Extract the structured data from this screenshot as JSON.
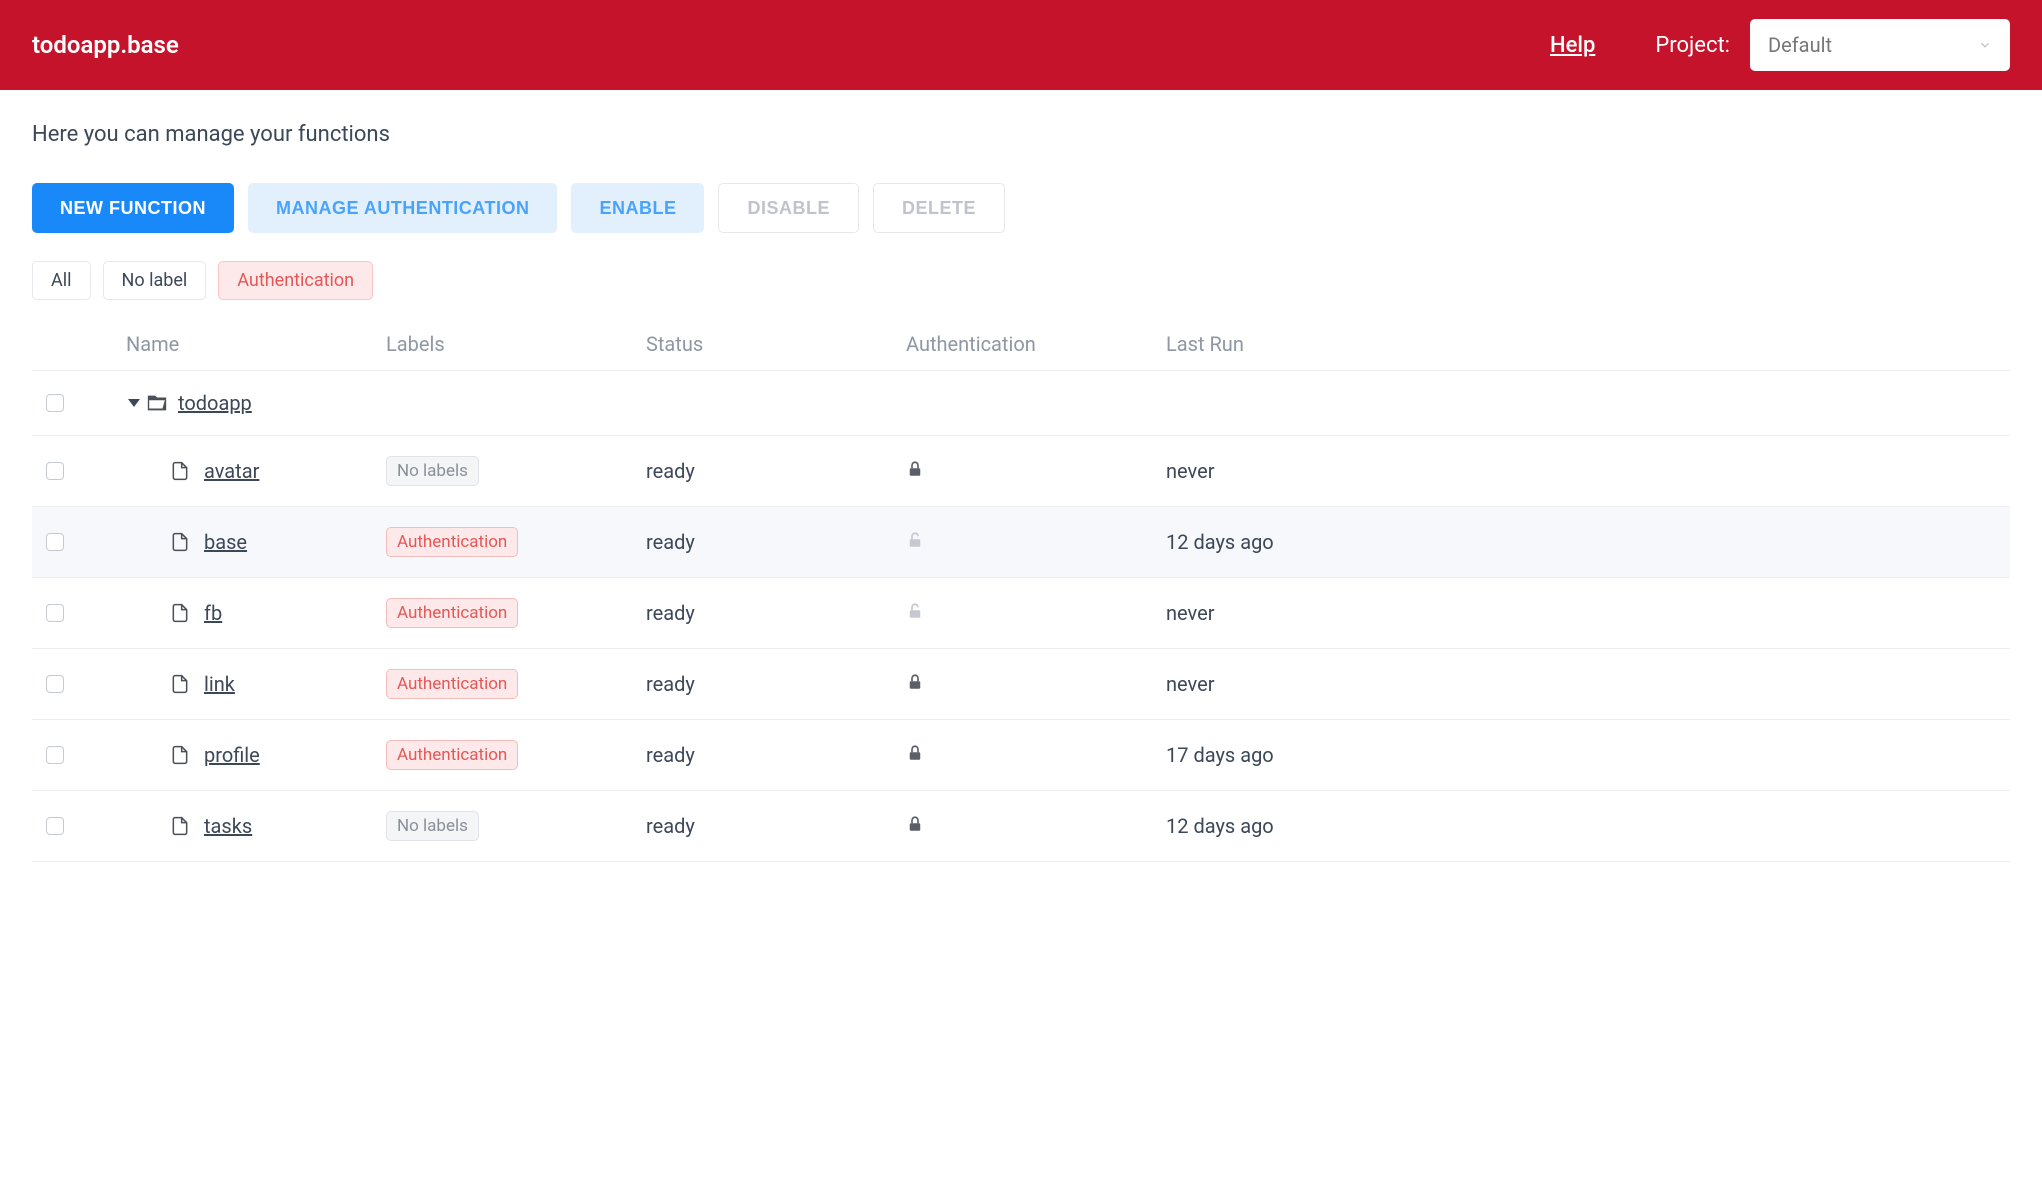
{
  "header": {
    "title": "todoapp.base",
    "help": "Help",
    "project_label": "Project:",
    "project_selected": "Default"
  },
  "subtitle": "Here you can manage your functions",
  "toolbar": {
    "new_function": "NEW FUNCTION",
    "manage_auth": "MANAGE AUTHENTICATION",
    "enable": "ENABLE",
    "disable": "DISABLE",
    "delete": "DELETE"
  },
  "filters": {
    "all": "All",
    "no_label": "No label",
    "authentication": "Authentication"
  },
  "columns": {
    "name": "Name",
    "labels": "Labels",
    "status": "Status",
    "auth": "Authentication",
    "last_run": "Last Run"
  },
  "folder": {
    "name": "todoapp"
  },
  "labels": {
    "no_labels": "No labels",
    "authentication": "Authentication"
  },
  "rows": [
    {
      "name": "avatar",
      "label_type": "none",
      "status": "ready",
      "auth_locked": true,
      "last_run": "never",
      "highlight": false
    },
    {
      "name": "base",
      "label_type": "auth",
      "status": "ready",
      "auth_locked": false,
      "last_run": "12 days ago",
      "highlight": true
    },
    {
      "name": "fb",
      "label_type": "auth",
      "status": "ready",
      "auth_locked": false,
      "last_run": "never",
      "highlight": false
    },
    {
      "name": "link",
      "label_type": "auth",
      "status": "ready",
      "auth_locked": true,
      "last_run": "never",
      "highlight": false
    },
    {
      "name": "profile",
      "label_type": "auth",
      "status": "ready",
      "auth_locked": true,
      "last_run": "17 days ago",
      "highlight": false
    },
    {
      "name": "tasks",
      "label_type": "none",
      "status": "ready",
      "auth_locked": true,
      "last_run": "12 days ago",
      "highlight": false
    }
  ]
}
